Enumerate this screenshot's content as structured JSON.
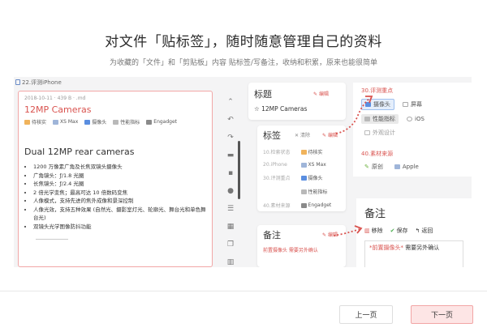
{
  "header": {
    "title": "对文件「贴标签」，随时随意管理自己的资料",
    "subtitle": "为收藏的「文件」和「剪贴板」内容 贴标签/写备注，收纳和积累，原来也能很简单"
  },
  "doc": {
    "source": "22.评测iPhone",
    "meta": "2018-10-11 · 439 B · .md",
    "heading": "12MP Cameras",
    "tags": [
      {
        "label": "待核实",
        "color": "#f0b35c"
      },
      {
        "label": "XS Max",
        "color": "#9fb5d9"
      },
      {
        "label": "摄像头",
        "color": "#5a8ee0"
      },
      {
        "label": "性能指标",
        "color": "#b9b9b9"
      },
      {
        "label": "Engadget",
        "color": "#8a8a8a"
      }
    ],
    "subheading": "Dual 12MP rear cameras",
    "bullets": [
      "1200 万像素广角及长焦双镜头摄像头",
      "广角镜头：ƒ/1.8 光圈",
      "长焦镜头：ƒ/2.4 光圈",
      "2 倍光学变焦；最高可达 10 倍数码变焦",
      "人像模式，支持先进的焦外成像和景深控制",
      "人像光效，支持五种效果 (自然光、摄影室灯光、轮廓光、舞台光和单色舞台光)",
      "双镜头光学图像防抖功能"
    ]
  },
  "toolbar": {
    "icons": [
      "chevron-up-icon",
      "undo-icon",
      "redo-icon",
      "folder-icon",
      "square-icon",
      "camera-icon",
      "list-icon",
      "chart-icon",
      "copy-icon",
      "trash-icon"
    ]
  },
  "title_card": {
    "label": "标题",
    "edit": "编辑",
    "value": "12MP Cameras"
  },
  "tag_card": {
    "label": "标签",
    "clear": "清除",
    "edit": "编辑",
    "rows": [
      {
        "key": "10.检索状态",
        "value": "待核实",
        "color": "#f0b35c"
      },
      {
        "key": "20.iPhone",
        "value": "XS Max",
        "color": "#9fb5d9"
      },
      {
        "key": "30.评测重点",
        "value": "摄像头",
        "color": "#5a8ee0"
      },
      {
        "key": "",
        "value": "性能指标",
        "color": "#b9b9b9"
      },
      {
        "key": "40.素材来源",
        "value": "Engadget",
        "color": "#8a8a8a"
      }
    ]
  },
  "note_card": {
    "label": "备注",
    "edit": "编辑",
    "value": "前置摄像头 需要另外确认"
  },
  "picker": {
    "group1_title": "30.评测重点",
    "group1": [
      {
        "label": "摄像头",
        "state": "selected-blue"
      },
      {
        "label": "屏幕",
        "state": "plain"
      },
      {
        "label": "性能指标",
        "state": "selected-grey"
      },
      {
        "label": "iOS",
        "state": "plain"
      },
      {
        "label": "外观设计",
        "state": "plain"
      }
    ],
    "group2_title": "40.素材来源",
    "group2": [
      {
        "label": "原创",
        "state": "plain"
      },
      {
        "label": "Apple",
        "state": "plain"
      }
    ]
  },
  "note_editor": {
    "title": "备注",
    "remove": "移除",
    "save": "保存",
    "back": "返回",
    "text_highlight": "*前置摄像头*",
    "text_rest": " 需要另外确认"
  },
  "footer": {
    "prev": "上一页",
    "next": "下一页"
  }
}
